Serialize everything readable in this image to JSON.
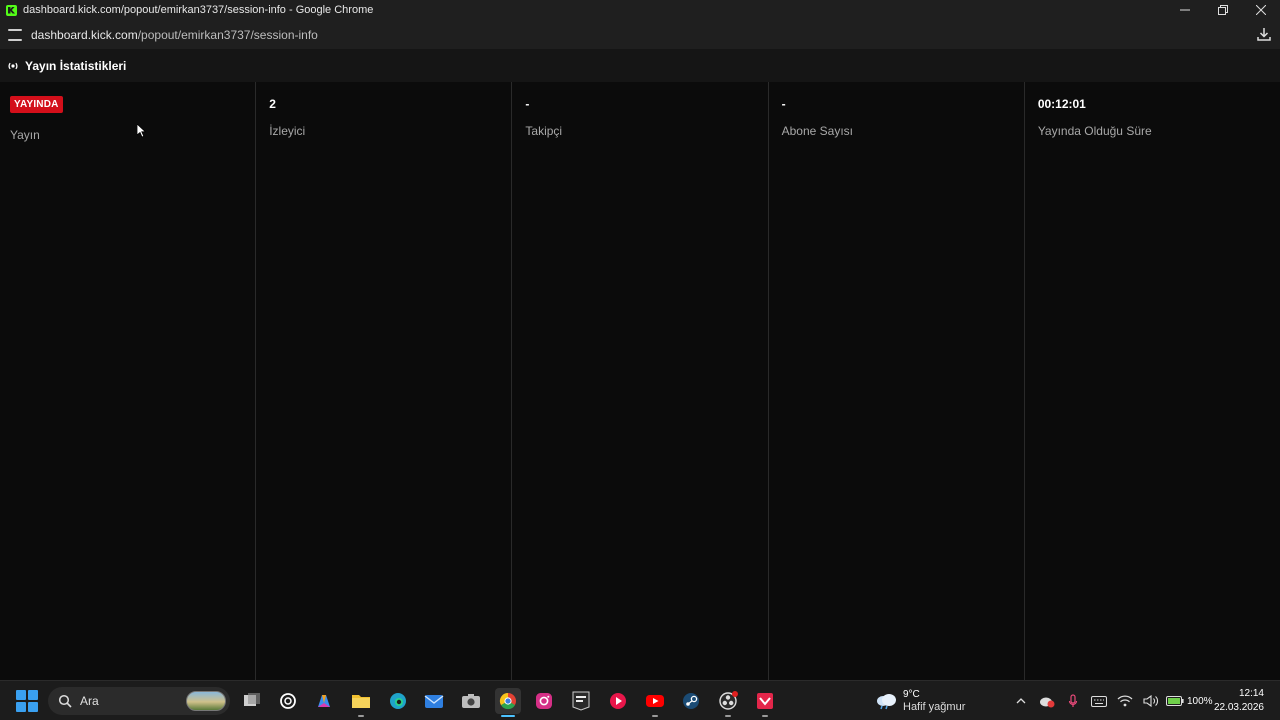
{
  "window": {
    "title": "dashboard.kick.com/popout/emirkan3737/session-info - Google Chrome",
    "url_host": "dashboard.kick.com",
    "url_path": "/popout/emirkan3737/session-info"
  },
  "page": {
    "title": "Yayın İstatistikleri"
  },
  "stats": [
    {
      "badge": "YAYINDA",
      "label": "Yayın"
    },
    {
      "value": "2",
      "label": "İzleyici"
    },
    {
      "value": "-",
      "label": "Takipçi"
    },
    {
      "value": "-",
      "label": "Abone Sayısı"
    },
    {
      "value": "00:12:01",
      "label": "Yayında Olduğu Süre"
    }
  ],
  "taskbar": {
    "search_label": "Ara",
    "weather_temp": "9°C",
    "weather_desc": "Hafif yağmur",
    "battery": "100%",
    "time": "12:14",
    "date": "22.03.2026"
  },
  "colors": {
    "live_badge": "#d30f1a",
    "kick_green": "#53fc18",
    "background": "#0b0b0b"
  }
}
